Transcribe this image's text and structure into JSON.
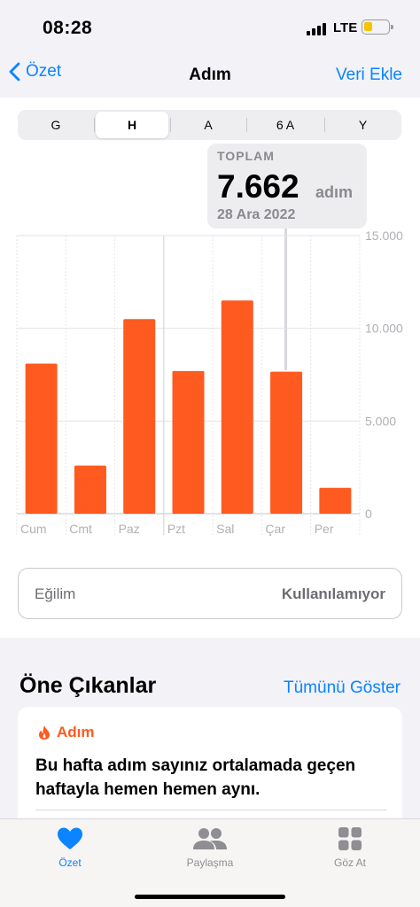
{
  "status": {
    "time": "08:28",
    "network": "LTE"
  },
  "nav": {
    "back_label": "Özet",
    "title": "Adım",
    "action_label": "Veri Ekle"
  },
  "segments": [
    "G",
    "H",
    "A",
    "6 A",
    "Y"
  ],
  "selected_segment": "H",
  "tooltip": {
    "label": "TOPLAM",
    "value": "7.662",
    "unit": "adım",
    "date": "28 Ara 2022"
  },
  "chart_data": {
    "type": "bar",
    "categories": [
      "Cum",
      "Cmt",
      "Paz",
      "Pzt",
      "Sal",
      "Çar",
      "Per"
    ],
    "values": [
      8100,
      2600,
      10500,
      7700,
      11500,
      7662,
      1400
    ],
    "ylim": [
      0,
      15000
    ],
    "y_ticks": [
      "15.000",
      "10.000",
      "5.000",
      "0"
    ],
    "y_tick_values": [
      15000,
      10000,
      5000,
      0
    ],
    "bar_color": "#ff5a1f",
    "grid": true
  },
  "trend": {
    "label": "Eğilim",
    "value": "Kullanılamıyor"
  },
  "highlights": {
    "title": "Öne Çıkanlar",
    "link": "Tümünü Göster",
    "card": {
      "category": "Adım",
      "text": "Bu hafta adım sayınız ortalamada geçen haftayla hemen hemen aynı."
    }
  },
  "tabs": [
    {
      "label": "Özet",
      "icon": "heart-icon",
      "active": true
    },
    {
      "label": "Paylaşma",
      "icon": "people-icon",
      "active": false
    },
    {
      "label": "Göz At",
      "icon": "grid-icon",
      "active": false
    }
  ],
  "colors": {
    "accent": "#0a84ff",
    "bar": "#ff5a1f"
  }
}
